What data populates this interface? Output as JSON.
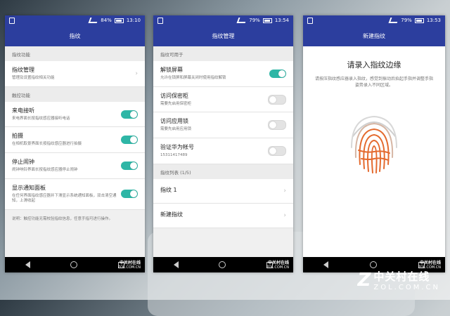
{
  "screen1": {
    "status": {
      "sim_icon": "sim-icon",
      "battery": "84%",
      "time": "13:10"
    },
    "title": "指纹",
    "section_fingerprint": "指纹功能",
    "manage": {
      "title": "指纹管理",
      "desc": "管理及设置指纹相关功能"
    },
    "section_touch": "触控功能",
    "items": [
      {
        "title": "来电接听",
        "desc": "来电界面长按指纹感应器接听电话",
        "on": true
      },
      {
        "title": "拍摄",
        "desc": "在相机取景界面长按指纹感应器进行拍摄",
        "on": true
      },
      {
        "title": "停止闹钟",
        "desc": "闹钟响铃界面长按指纹感应器停止闹钟",
        "on": true
      },
      {
        "title": "显示通知面板",
        "desc": "在任何界面指纹感应器并下滑显示系统通知面板，双击清空通知，上滑收起",
        "on": true
      }
    ],
    "note": "说明：触控功能无需校验指纹信息，任意手指可进行操作。"
  },
  "screen2": {
    "status": {
      "battery": "79%",
      "time": "13:54"
    },
    "title": "指纹管理",
    "section_usage": "指纹可用于",
    "items": [
      {
        "title": "解锁屏幕",
        "desc": "允许在锁屏和屏幕关闭时使用指纹解锁",
        "on": true
      },
      {
        "title": "访问保密柜",
        "desc": "需要先启用保密柜",
        "on": false
      },
      {
        "title": "访问应用锁",
        "desc": "需要先启用应用锁",
        "on": false
      },
      {
        "title": "验证华为帐号",
        "desc": "15311417489",
        "on": false
      }
    ],
    "section_list": "指纹列表 (1/5)",
    "list": [
      {
        "title": "指纹 1"
      },
      {
        "title": "新建指纹"
      }
    ]
  },
  "screen3": {
    "status": {
      "battery": "79%",
      "time": "13:53"
    },
    "title": "新建指纹",
    "heading": "请录入指纹边缘",
    "desc": "请按压指纹感应器录入指纹，感觉到振动后抬起手指并调整手指姿势录入不同区域。"
  },
  "mini_watermark": {
    "brand": "中关村在线",
    "url": "ZOL.COM.CN"
  },
  "watermark": {
    "logo": "Z",
    "brand": "中关村在线",
    "url": "ZOL.COM.CN"
  },
  "colors": {
    "header": "#2c3e9e",
    "toggle_on": "#2eb6a6",
    "fingerprint": "#e46a2e"
  }
}
